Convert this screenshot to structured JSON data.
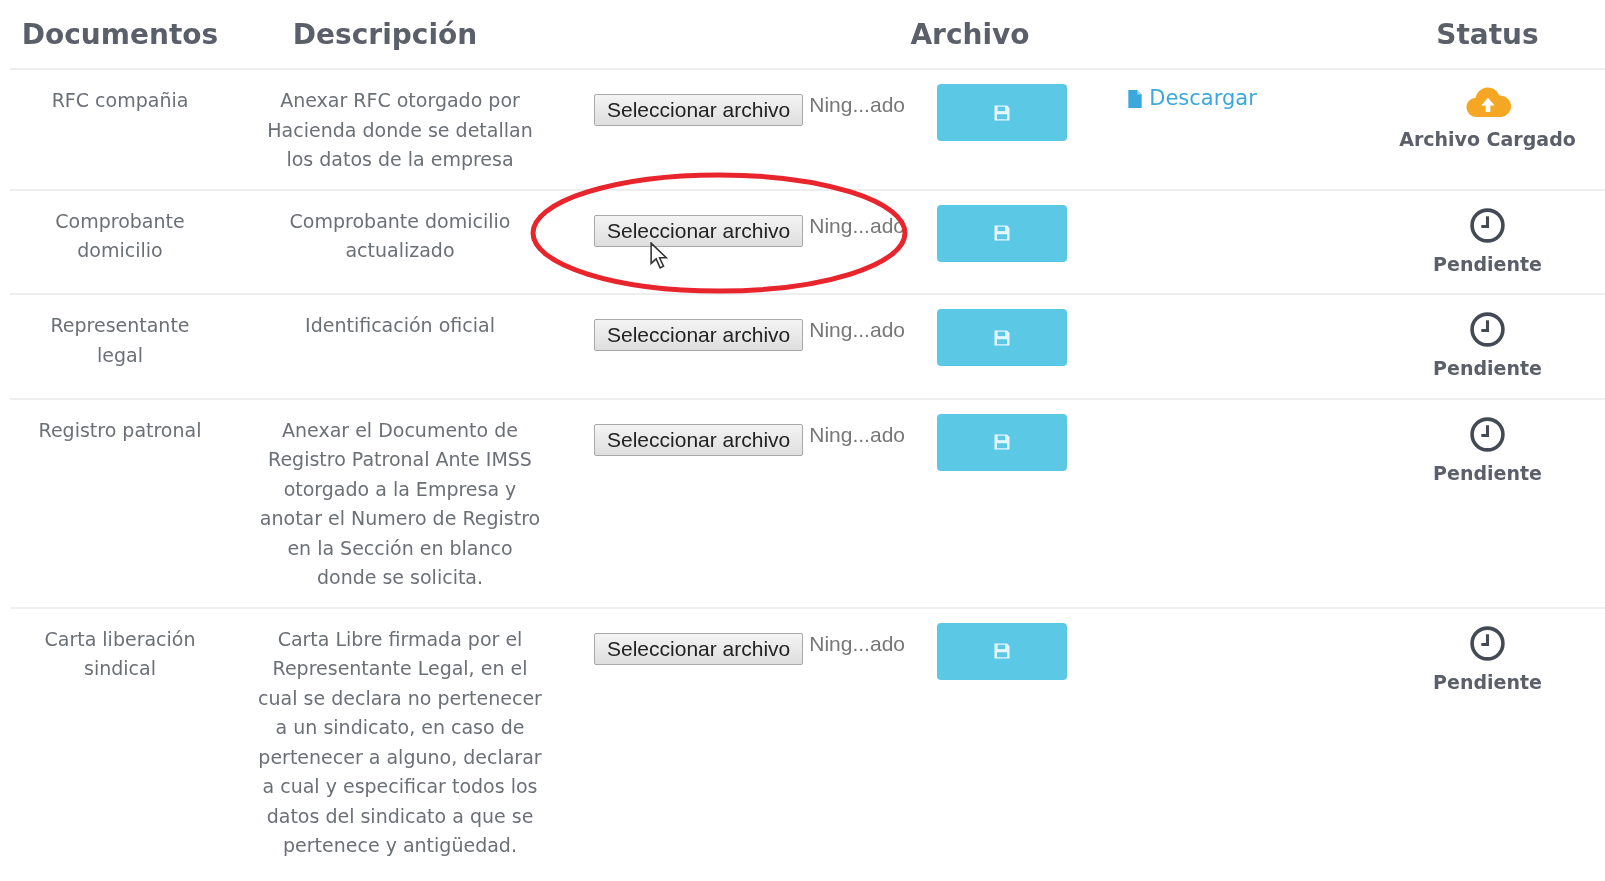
{
  "table": {
    "columns": [
      "Documentos",
      "Descripción",
      "Archivo",
      "Status"
    ],
    "rows": [
      {
        "document": "RFC compañia",
        "description": "Anexar RFC otorgado por Hacienda donde se detallan los datos de la empresa",
        "file_button": "Seleccionar archivo",
        "file_name": "Ning...ado",
        "download": "Descargar",
        "status": {
          "kind": "uploaded",
          "label": "Archivo Cargado"
        }
      },
      {
        "document": "Comprobante domicilio",
        "description": "Comprobante domicilio actualizado",
        "file_button": "Seleccionar archivo",
        "file_name": "Ning...ado",
        "status": {
          "kind": "pending",
          "label": "Pendiente"
        },
        "highlighted": true
      },
      {
        "document": "Representante legal",
        "description": "Identificación oficial",
        "file_button": "Seleccionar archivo",
        "file_name": "Ning...ado",
        "status": {
          "kind": "pending",
          "label": "Pendiente"
        }
      },
      {
        "document": "Registro patronal",
        "description": "Anexar el Documento de Registro Patronal Ante IMSS otorgado a la Empresa y anotar el Numero de Registro en la Sección en blanco donde se solicita.",
        "file_button": "Seleccionar archivo",
        "file_name": "Ning...ado",
        "status": {
          "kind": "pending",
          "label": "Pendiente"
        }
      },
      {
        "document": "Carta liberación sindical",
        "description": "Carta Libre firmada por el Representante Legal, en el cual se declara no pertenecer a un sindicato, en caso de pertenecer a alguno, declarar a cual y especificar todos los datos del sindicato a que se pertenece y antigüedad.",
        "file_button": "Seleccionar archivo",
        "file_name": "Ning...ado",
        "status": {
          "kind": "pending",
          "label": "Pendiente"
        }
      }
    ]
  }
}
